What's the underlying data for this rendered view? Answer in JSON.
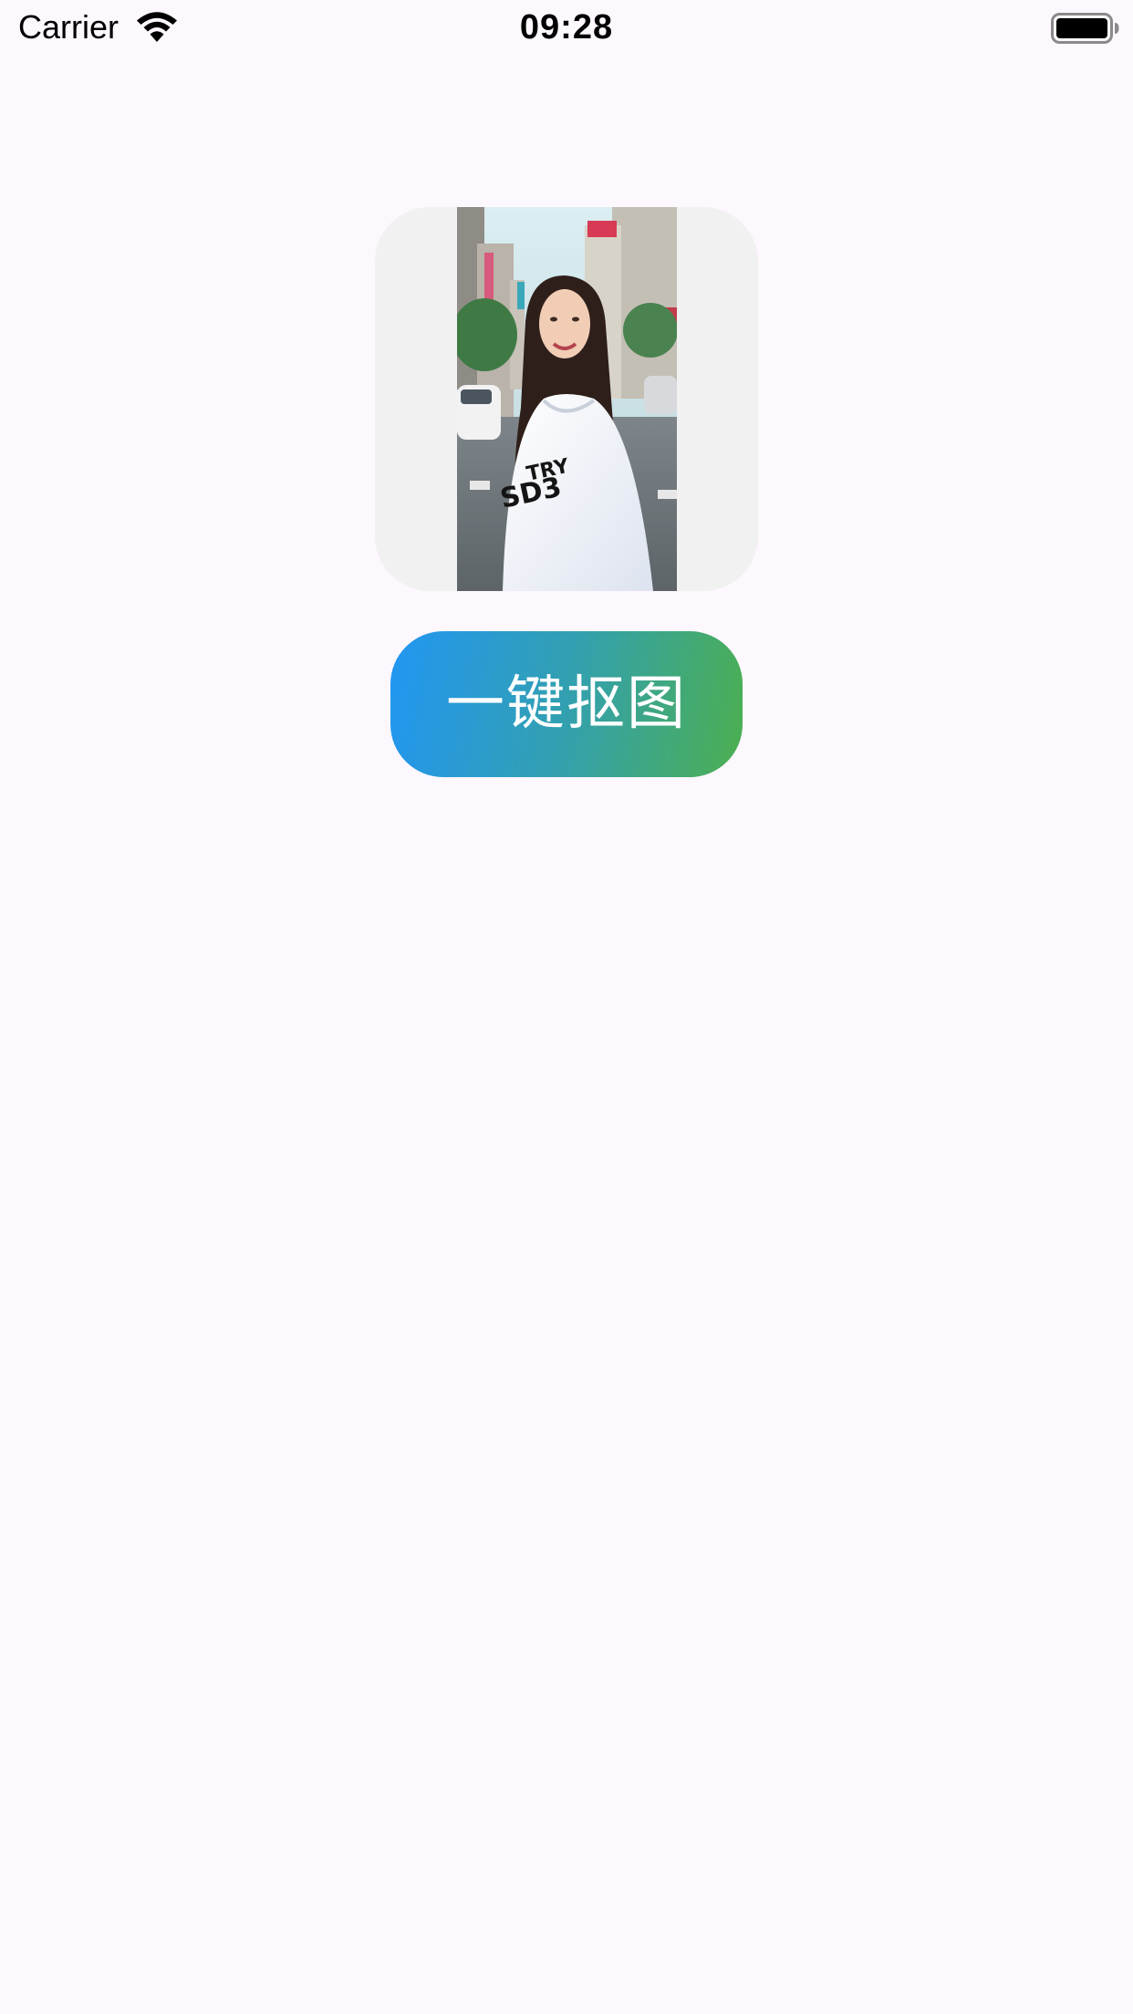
{
  "status_bar": {
    "carrier": "Carrier",
    "time": "09:28",
    "icons": [
      "wifi-icon",
      "battery-icon"
    ]
  },
  "image_card": {
    "photo_icon": "portrait-photo"
  },
  "action_button": {
    "label": "一键抠图",
    "gradient_start": "#2196f3",
    "gradient_end": "#4caf50"
  },
  "colors": {
    "background": "#fdf7fe",
    "card_background": "#f1f1f1"
  }
}
